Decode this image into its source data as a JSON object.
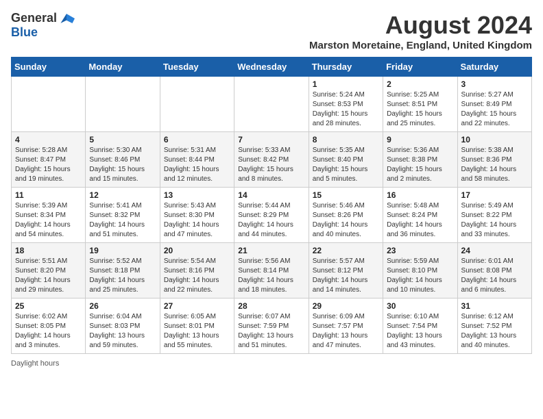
{
  "header": {
    "logo_general": "General",
    "logo_blue": "Blue",
    "month_title": "August 2024",
    "location": "Marston Moretaine, England, United Kingdom"
  },
  "weekdays": [
    "Sunday",
    "Monday",
    "Tuesday",
    "Wednesday",
    "Thursday",
    "Friday",
    "Saturday"
  ],
  "weeks": [
    [
      {
        "day": "",
        "info": ""
      },
      {
        "day": "",
        "info": ""
      },
      {
        "day": "",
        "info": ""
      },
      {
        "day": "",
        "info": ""
      },
      {
        "day": "1",
        "info": "Sunrise: 5:24 AM\nSunset: 8:53 PM\nDaylight: 15 hours and 28 minutes."
      },
      {
        "day": "2",
        "info": "Sunrise: 5:25 AM\nSunset: 8:51 PM\nDaylight: 15 hours and 25 minutes."
      },
      {
        "day": "3",
        "info": "Sunrise: 5:27 AM\nSunset: 8:49 PM\nDaylight: 15 hours and 22 minutes."
      }
    ],
    [
      {
        "day": "4",
        "info": "Sunrise: 5:28 AM\nSunset: 8:47 PM\nDaylight: 15 hours and 19 minutes."
      },
      {
        "day": "5",
        "info": "Sunrise: 5:30 AM\nSunset: 8:46 PM\nDaylight: 15 hours and 15 minutes."
      },
      {
        "day": "6",
        "info": "Sunrise: 5:31 AM\nSunset: 8:44 PM\nDaylight: 15 hours and 12 minutes."
      },
      {
        "day": "7",
        "info": "Sunrise: 5:33 AM\nSunset: 8:42 PM\nDaylight: 15 hours and 8 minutes."
      },
      {
        "day": "8",
        "info": "Sunrise: 5:35 AM\nSunset: 8:40 PM\nDaylight: 15 hours and 5 minutes."
      },
      {
        "day": "9",
        "info": "Sunrise: 5:36 AM\nSunset: 8:38 PM\nDaylight: 15 hours and 2 minutes."
      },
      {
        "day": "10",
        "info": "Sunrise: 5:38 AM\nSunset: 8:36 PM\nDaylight: 14 hours and 58 minutes."
      }
    ],
    [
      {
        "day": "11",
        "info": "Sunrise: 5:39 AM\nSunset: 8:34 PM\nDaylight: 14 hours and 54 minutes."
      },
      {
        "day": "12",
        "info": "Sunrise: 5:41 AM\nSunset: 8:32 PM\nDaylight: 14 hours and 51 minutes."
      },
      {
        "day": "13",
        "info": "Sunrise: 5:43 AM\nSunset: 8:30 PM\nDaylight: 14 hours and 47 minutes."
      },
      {
        "day": "14",
        "info": "Sunrise: 5:44 AM\nSunset: 8:29 PM\nDaylight: 14 hours and 44 minutes."
      },
      {
        "day": "15",
        "info": "Sunrise: 5:46 AM\nSunset: 8:26 PM\nDaylight: 14 hours and 40 minutes."
      },
      {
        "day": "16",
        "info": "Sunrise: 5:48 AM\nSunset: 8:24 PM\nDaylight: 14 hours and 36 minutes."
      },
      {
        "day": "17",
        "info": "Sunrise: 5:49 AM\nSunset: 8:22 PM\nDaylight: 14 hours and 33 minutes."
      }
    ],
    [
      {
        "day": "18",
        "info": "Sunrise: 5:51 AM\nSunset: 8:20 PM\nDaylight: 14 hours and 29 minutes."
      },
      {
        "day": "19",
        "info": "Sunrise: 5:52 AM\nSunset: 8:18 PM\nDaylight: 14 hours and 25 minutes."
      },
      {
        "day": "20",
        "info": "Sunrise: 5:54 AM\nSunset: 8:16 PM\nDaylight: 14 hours and 22 minutes."
      },
      {
        "day": "21",
        "info": "Sunrise: 5:56 AM\nSunset: 8:14 PM\nDaylight: 14 hours and 18 minutes."
      },
      {
        "day": "22",
        "info": "Sunrise: 5:57 AM\nSunset: 8:12 PM\nDaylight: 14 hours and 14 minutes."
      },
      {
        "day": "23",
        "info": "Sunrise: 5:59 AM\nSunset: 8:10 PM\nDaylight: 14 hours and 10 minutes."
      },
      {
        "day": "24",
        "info": "Sunrise: 6:01 AM\nSunset: 8:08 PM\nDaylight: 14 hours and 6 minutes."
      }
    ],
    [
      {
        "day": "25",
        "info": "Sunrise: 6:02 AM\nSunset: 8:05 PM\nDaylight: 14 hours and 3 minutes."
      },
      {
        "day": "26",
        "info": "Sunrise: 6:04 AM\nSunset: 8:03 PM\nDaylight: 13 hours and 59 minutes."
      },
      {
        "day": "27",
        "info": "Sunrise: 6:05 AM\nSunset: 8:01 PM\nDaylight: 13 hours and 55 minutes."
      },
      {
        "day": "28",
        "info": "Sunrise: 6:07 AM\nSunset: 7:59 PM\nDaylight: 13 hours and 51 minutes."
      },
      {
        "day": "29",
        "info": "Sunrise: 6:09 AM\nSunset: 7:57 PM\nDaylight: 13 hours and 47 minutes."
      },
      {
        "day": "30",
        "info": "Sunrise: 6:10 AM\nSunset: 7:54 PM\nDaylight: 13 hours and 43 minutes."
      },
      {
        "day": "31",
        "info": "Sunrise: 6:12 AM\nSunset: 7:52 PM\nDaylight: 13 hours and 40 minutes."
      }
    ]
  ],
  "footer": {
    "daylight_label": "Daylight hours"
  }
}
